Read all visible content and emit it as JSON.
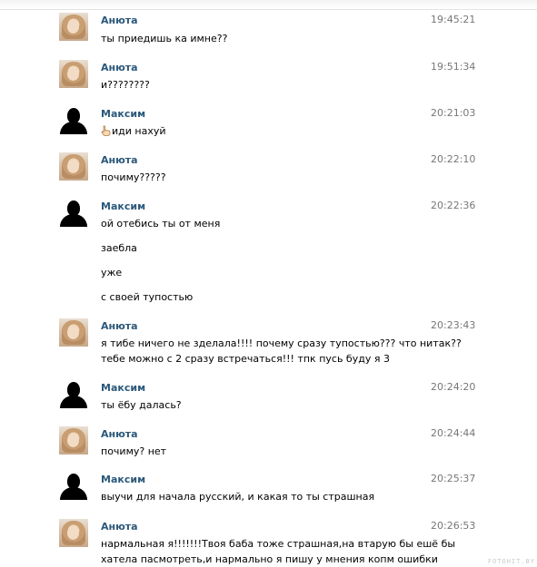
{
  "messages": [
    {
      "author": "Анюта",
      "time": "19:45:21",
      "lines": [
        "ты приедишь ка имне??"
      ]
    },
    {
      "author": "Анюта",
      "time": "19:51:34",
      "lines": [
        "и????????"
      ]
    },
    {
      "author": "Максим",
      "time": "20:21:03",
      "lines": [
        "иди нахуй"
      ]
    },
    {
      "author": "Анюта",
      "time": "20:22:10",
      "lines": [
        "почиму?????"
      ]
    },
    {
      "author": "Максим",
      "time": "20:22:36",
      "lines": [
        "ой отебись ты от меня",
        "заебла",
        "уже",
        "с своей тупостью"
      ]
    },
    {
      "author": "Анюта",
      "time": "20:23:43",
      "lines": [
        "я тибе ничего не зделала!!!! почему сразу тупостью??? что нитак??",
        "тебе можно с 2 сразу встречаться!!! тпк пусь буду я 3"
      ]
    },
    {
      "author": "Максим",
      "time": "20:24:20",
      "lines": [
        "ты ёбу далась?"
      ]
    },
    {
      "author": "Анюта",
      "time": "20:24:44",
      "lines": [
        "почиму? нет"
      ]
    },
    {
      "author": "Максим",
      "time": "20:25:37",
      "lines": [
        "выучи для начала русский, и какая то ты страшная"
      ]
    },
    {
      "author": "Анюта",
      "time": "20:26:53",
      "lines": [
        "нармальная я!!!!!!!Твоя баба тоже страшная,на втарую бы ешё бы",
        "хатела пасмотреть,и нармально я пишу у мнения копм ошибки"
      ]
    }
  ],
  "watermark": "FOTOHIT.BY",
  "icons": {
    "girl_avatar": "user-photo-icon",
    "man_avatar": "silhouette-icon",
    "finger": "pointing-hand-icon"
  },
  "colors": {
    "author": "#2b587a",
    "time": "#777777",
    "text": "#000000"
  }
}
